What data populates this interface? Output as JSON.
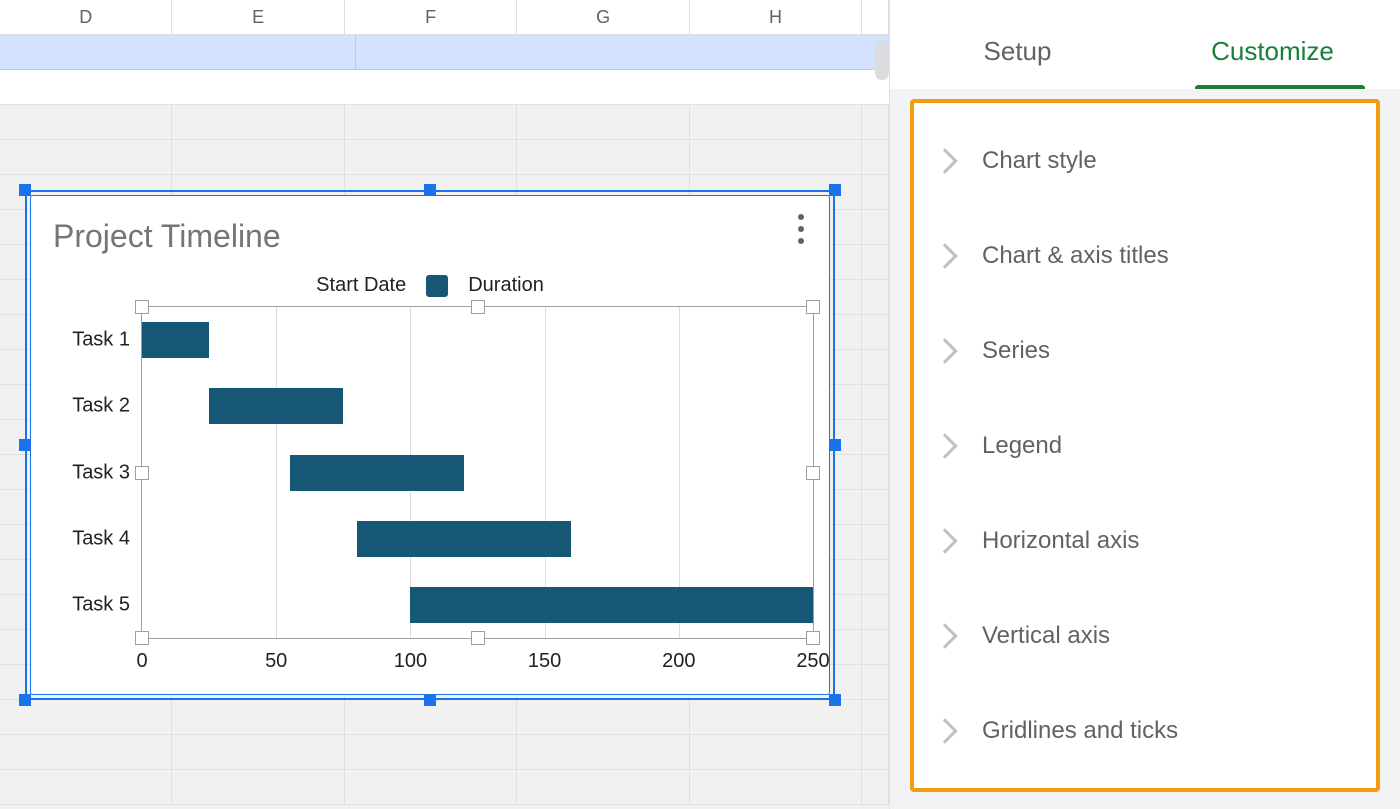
{
  "columns": [
    "D",
    "E",
    "F",
    "G",
    "H",
    ""
  ],
  "tabs": {
    "setup": "Setup",
    "customize": "Customize",
    "active": "customize"
  },
  "accordion": [
    "Chart style",
    "Chart & axis titles",
    "Series",
    "Legend",
    "Horizontal axis",
    "Vertical axis",
    "Gridlines and ticks"
  ],
  "chart_data": {
    "type": "bar",
    "orientation": "horizontal",
    "stacked": true,
    "title": "Project Timeline",
    "categories": [
      "Task 1",
      "Task 2",
      "Task 3",
      "Task 4",
      "Task 5"
    ],
    "series": [
      {
        "name": "Start Date",
        "values": [
          0,
          25,
          55,
          80,
          100
        ],
        "color": "transparent"
      },
      {
        "name": "Duration",
        "values": [
          25,
          50,
          65,
          80,
          150
        ],
        "color": "#155775"
      }
    ],
    "xlabel": "",
    "ylabel": "",
    "xlim": [
      0,
      250
    ],
    "x_ticks": [
      0,
      50,
      100,
      150,
      200,
      250
    ],
    "legend_position": "top"
  }
}
